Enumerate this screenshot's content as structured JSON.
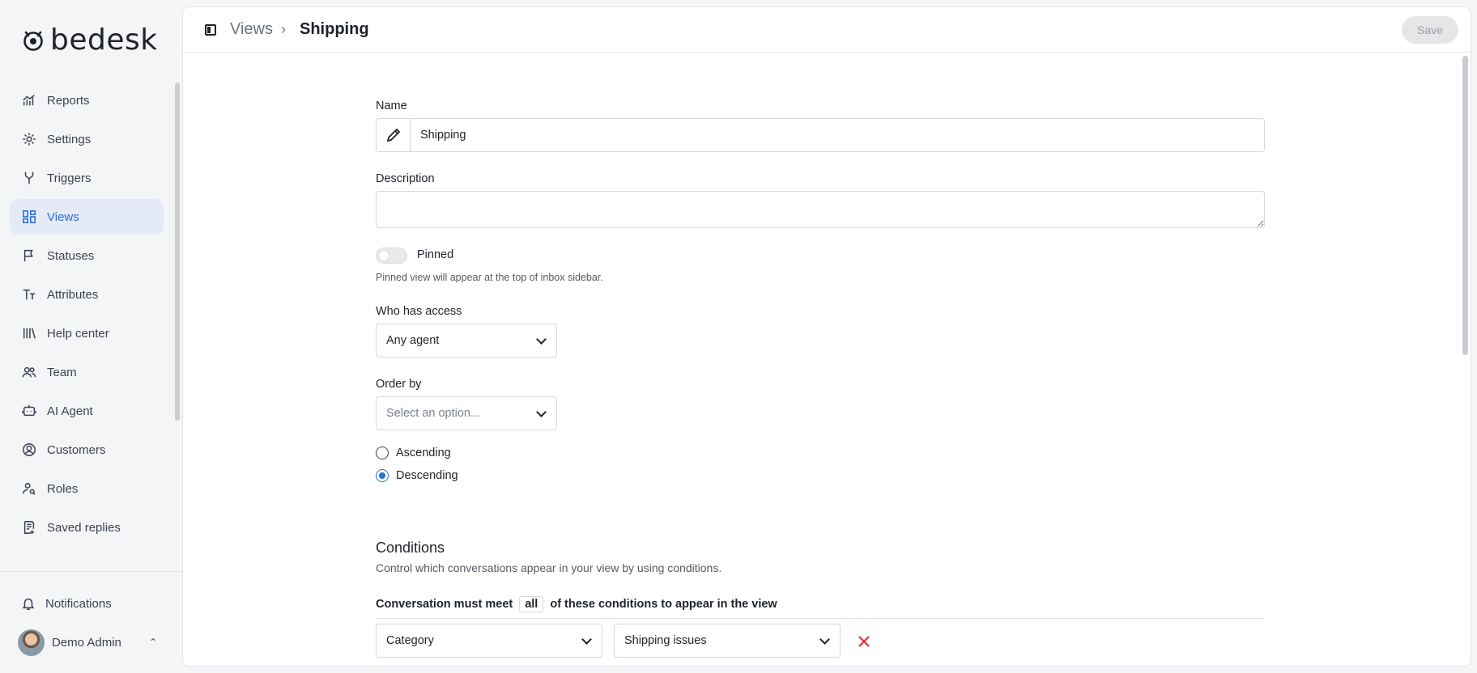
{
  "brand": {
    "name": "bedesk"
  },
  "sidebar": {
    "items": [
      {
        "label": "Reports",
        "icon": "chart-icon"
      },
      {
        "label": "Settings",
        "icon": "gear-icon"
      },
      {
        "label": "Triggers",
        "icon": "branch-icon"
      },
      {
        "label": "Views",
        "icon": "grid-icon",
        "active": true
      },
      {
        "label": "Statuses",
        "icon": "flag-icon"
      },
      {
        "label": "Attributes",
        "icon": "text-size-icon"
      },
      {
        "label": "Help center",
        "icon": "library-icon"
      },
      {
        "label": "Team",
        "icon": "users-icon"
      },
      {
        "label": "AI Agent",
        "icon": "bot-icon"
      },
      {
        "label": "Customers",
        "icon": "user-circle-icon"
      },
      {
        "label": "Roles",
        "icon": "user-key-icon"
      },
      {
        "label": "Saved replies",
        "icon": "saved-reply-icon"
      }
    ],
    "notifications_label": "Notifications",
    "user_name": "Demo Admin"
  },
  "header": {
    "breadcrumb_parent": "Views",
    "breadcrumb_separator": "›",
    "breadcrumb_current": "Shipping",
    "save_label": "Save"
  },
  "form": {
    "name_label": "Name",
    "name_value": "Shipping",
    "description_label": "Description",
    "description_value": "",
    "pinned_label": "Pinned",
    "pinned_on": false,
    "pinned_help": "Pinned view will appear at the top of inbox sidebar.",
    "access_label": "Who has access",
    "access_value": "Any agent",
    "order_label": "Order by",
    "order_placeholder": "Select an option...",
    "ascending_label": "Ascending",
    "descending_label": "Descending",
    "order_direction": "Descending"
  },
  "conditions": {
    "title": "Conditions",
    "subtitle": "Control which conversations appear in your view by using conditions.",
    "rule_prefix": "Conversation must meet",
    "rule_match": "all",
    "rule_suffix": "of these conditions to appear in the view",
    "rows": [
      {
        "field": "Category",
        "value": "Shipping issues"
      }
    ]
  },
  "colors": {
    "accent": "#2a6bd6",
    "active_nav_bg": "#e4ebf7",
    "danger": "#e03131"
  }
}
